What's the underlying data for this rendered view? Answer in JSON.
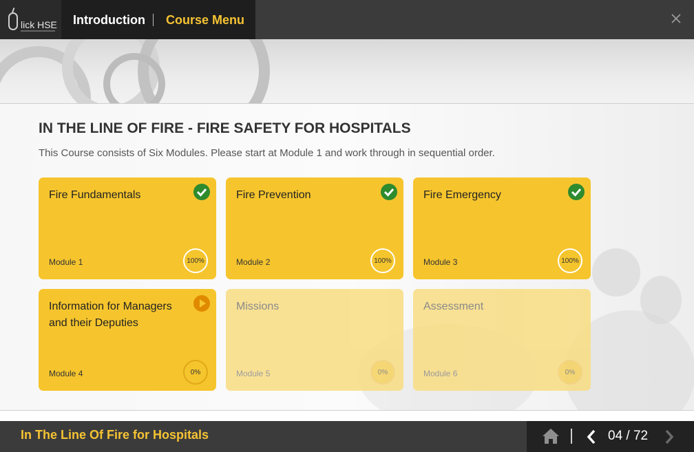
{
  "header": {
    "logo_text": "lick HSE",
    "nav_intro": "Introduction",
    "nav_menu": "Course Menu"
  },
  "course": {
    "title": "IN THE LINE OF FIRE - FIRE SAFETY FOR HOSPITALS",
    "description": "This Course consists of Six Modules. Please start at Module 1 and work through in sequential order."
  },
  "modules": [
    {
      "title": "Fire Fundamentals",
      "module": "Module 1",
      "progress": "100%",
      "status": "complete-check-icon"
    },
    {
      "title": "Fire Prevention",
      "module": "Module 2",
      "progress": "100%",
      "status": "complete-check-icon"
    },
    {
      "title": "Fire Emergency",
      "module": "Module 3",
      "progress": "100%",
      "status": "complete-check-icon"
    },
    {
      "title": "Information for Managers and their Deputies",
      "module": "Module 4",
      "progress": "0%",
      "status": "play-icon"
    },
    {
      "title": "Missions",
      "module": "Module 5",
      "progress": "0%",
      "status": "locked"
    },
    {
      "title": "Assessment",
      "module": "Module 6",
      "progress": "0%",
      "status": "locked"
    }
  ],
  "footer": {
    "title": "In The Line Of Fire for Hospitals",
    "page": "04 / 72"
  },
  "colors": {
    "accent": "#f6c333",
    "card": "#f6c52d",
    "check": "#2e8b2e",
    "play": "#e08a00"
  }
}
